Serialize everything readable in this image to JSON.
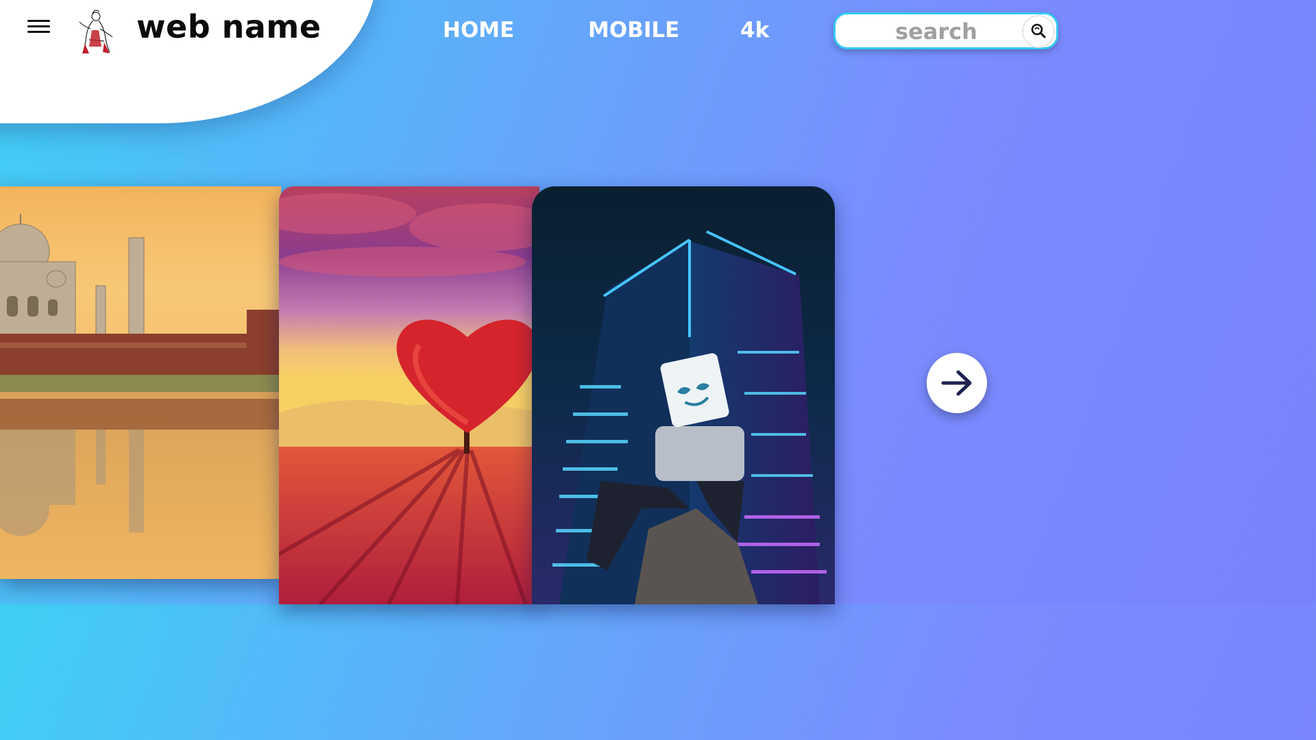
{
  "header": {
    "site_name": "web name",
    "menu_icon": "hamburger-menu-icon",
    "logo": "illustrated-figure-logo"
  },
  "nav": {
    "items": [
      {
        "label": "HOME"
      },
      {
        "label": "MOBILE"
      },
      {
        "label": "4k"
      }
    ]
  },
  "search": {
    "placeholder": "search",
    "value": "",
    "icon": "magnifier-icon"
  },
  "gallery": {
    "cards": [
      {
        "subject": "Taj Mahal at sunset with reflection"
      },
      {
        "subject": "Heart-shaped red tree over tulip field"
      },
      {
        "subject": "Marshmello figure on neon skyscraper",
        "watermark": ""
      }
    ],
    "next_icon": "arrow-right-icon"
  },
  "colors": {
    "bg_start": "#3fd0f4",
    "bg_end": "#7a82fa",
    "search_border": "#33c9f0"
  }
}
